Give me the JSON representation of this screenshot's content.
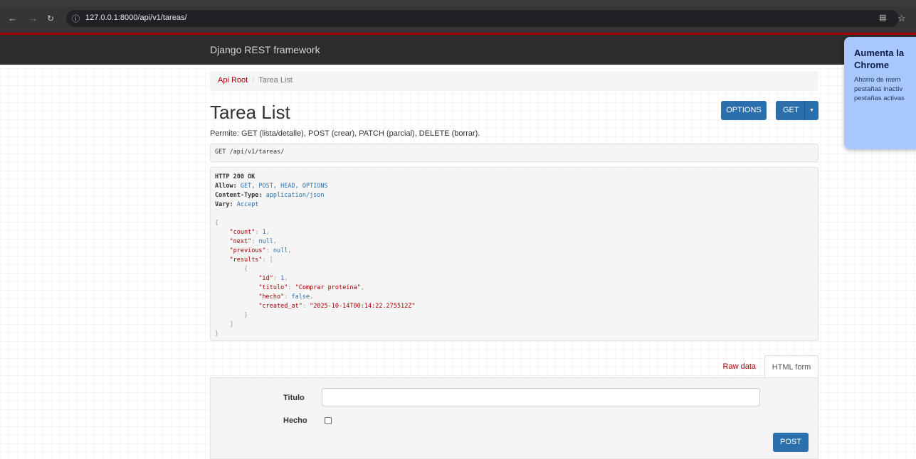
{
  "browser": {
    "url": "127.0.0.1:8000/api/v1/tareas/"
  },
  "navbar": {
    "brand": "Django REST framework"
  },
  "breadcrumb": {
    "root": "Api Root",
    "separator": "/",
    "current": "Tarea List"
  },
  "page": {
    "title": "Tarea List",
    "description": "Permite: GET (lista/detalle), POST (crear), PATCH (parcial), DELETE (borrar).",
    "options_label": "OPTIONS",
    "get_label": "GET"
  },
  "request": {
    "line": "GET /api/v1/tareas/"
  },
  "response": {
    "status": "HTTP 200 OK",
    "headers": [
      {
        "name": "Allow:",
        "value": "GET, POST, HEAD, OPTIONS"
      },
      {
        "name": "Content-Type:",
        "value": "application/json"
      },
      {
        "name": "Vary:",
        "value": "Accept"
      }
    ],
    "body": {
      "open": "{",
      "count_key": "\"count\"",
      "count_val": "1",
      "next_key": "\"next\"",
      "next_val": "null",
      "previous_key": "\"previous\"",
      "previous_val": "null",
      "results_key": "\"results\"",
      "results_open": "[",
      "item_open": "{",
      "id_key": "\"id\"",
      "id_val": "1",
      "titulo_key": "\"titulo\"",
      "titulo_val": "\"Comprar proteína\"",
      "hecho_key": "\"hecho\"",
      "hecho_val": "false",
      "created_key": "\"created_at\"",
      "created_val": "\"2025-10-14T00:14:22.275512Z\"",
      "item_close": "}",
      "results_close": "]",
      "close": "}"
    }
  },
  "tabs": {
    "raw": "Raw data",
    "html": "HTML form"
  },
  "form": {
    "titulo_label": "Titulo",
    "titulo_value": "",
    "hecho_label": "Hecho",
    "hecho_checked": false,
    "post_label": "POST"
  },
  "popup": {
    "title": "Aumenta la\nChrome",
    "body": "Ahorro de mem\npestañas inactiv\npestañas activas"
  },
  "colors": {
    "accent": "#a30000",
    "button": "#2c6fad",
    "navbar": "#2c2c2c",
    "popup": "#a8c7fa"
  }
}
